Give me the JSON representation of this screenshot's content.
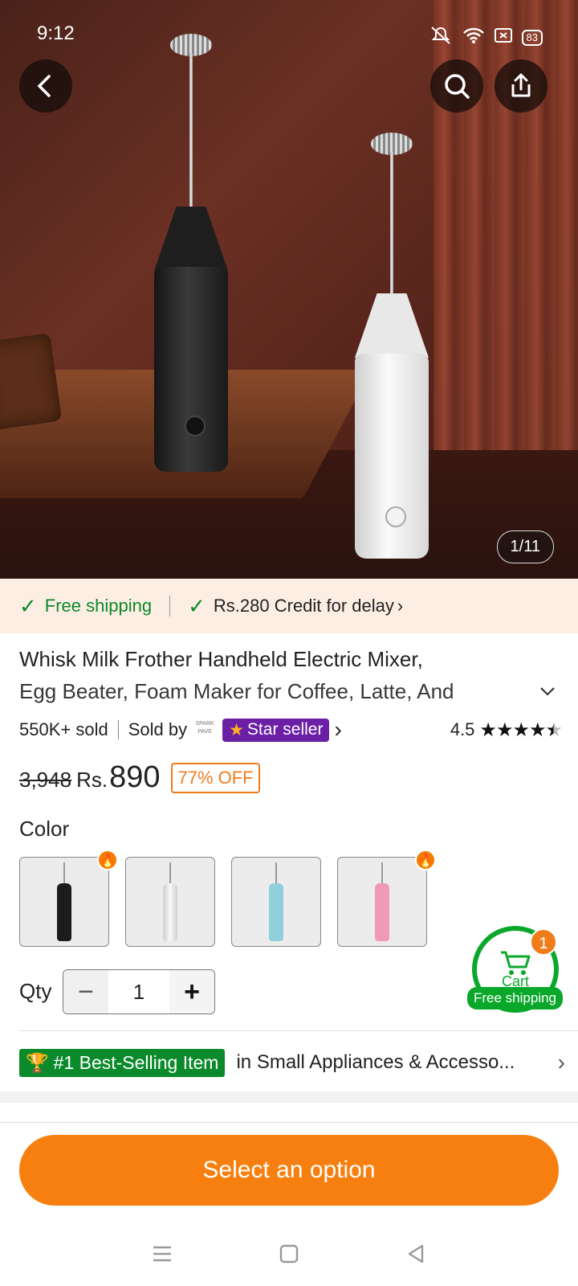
{
  "status": {
    "time": "9:12",
    "battery": "83"
  },
  "gallery": {
    "counter": "1/11"
  },
  "shipping": {
    "free": "Free shipping",
    "credit": "Rs.280 Credit for delay"
  },
  "product": {
    "title_line1": "Whisk Milk Frother Handheld Electric Mixer,",
    "title_line2": "Egg Beater, Foam Maker for Coffee, Latte, And",
    "sold": "550K+ sold",
    "sold_by": "Sold by",
    "seller_logo_text": "SPARK PAVE",
    "seller_badge": "Star seller",
    "rating": "4.5",
    "stars_count": 4.5,
    "old_price": "3,948",
    "currency": "Rs.",
    "price": "890",
    "discount": "77% OFF"
  },
  "color": {
    "label": "Color",
    "options": [
      "black",
      "white",
      "light-blue",
      "pink"
    ]
  },
  "qty": {
    "label": "Qty",
    "value": "1",
    "minus": "−",
    "plus": "+"
  },
  "cart": {
    "label": "Cart",
    "count": "1",
    "shipping": "Free shipping"
  },
  "best": {
    "badge": "#1 Best-Selling Item",
    "text": "in Small Appliances & Accesso..."
  },
  "cta": {
    "label": "Select an option"
  },
  "colors": {
    "accent": "#f77f0f",
    "green": "#0a8a2a",
    "seller_purple": "#6a1fa5"
  }
}
